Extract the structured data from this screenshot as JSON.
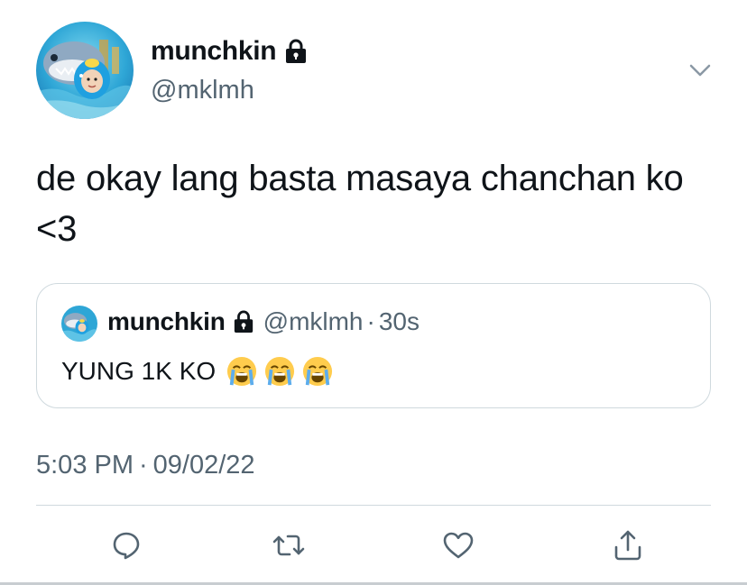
{
  "author": {
    "display_name": "munchkin",
    "handle": "@mklmh",
    "avatar": "shark-hood-avatar",
    "verified_lock": "lock-icon"
  },
  "tweet": {
    "text": "de okay lang basta masaya chanchan ko <3",
    "time": "5:03 PM",
    "separator": "·",
    "date": "09/02/22"
  },
  "quoted_tweet": {
    "display_name": "munchkin",
    "handle": "@mklmh",
    "separator": "·",
    "age": "30s",
    "text": "YUNG 1K KO",
    "emojis": [
      "loudly-crying-face",
      "loudly-crying-face",
      "loudly-crying-face"
    ]
  },
  "actions": [
    "reply-icon",
    "retweet-icon",
    "like-icon",
    "share-icon"
  ],
  "colors": {
    "text_primary": "#0f1419",
    "text_secondary": "#536471",
    "border": "#cfd9de",
    "icon": "#536471"
  }
}
